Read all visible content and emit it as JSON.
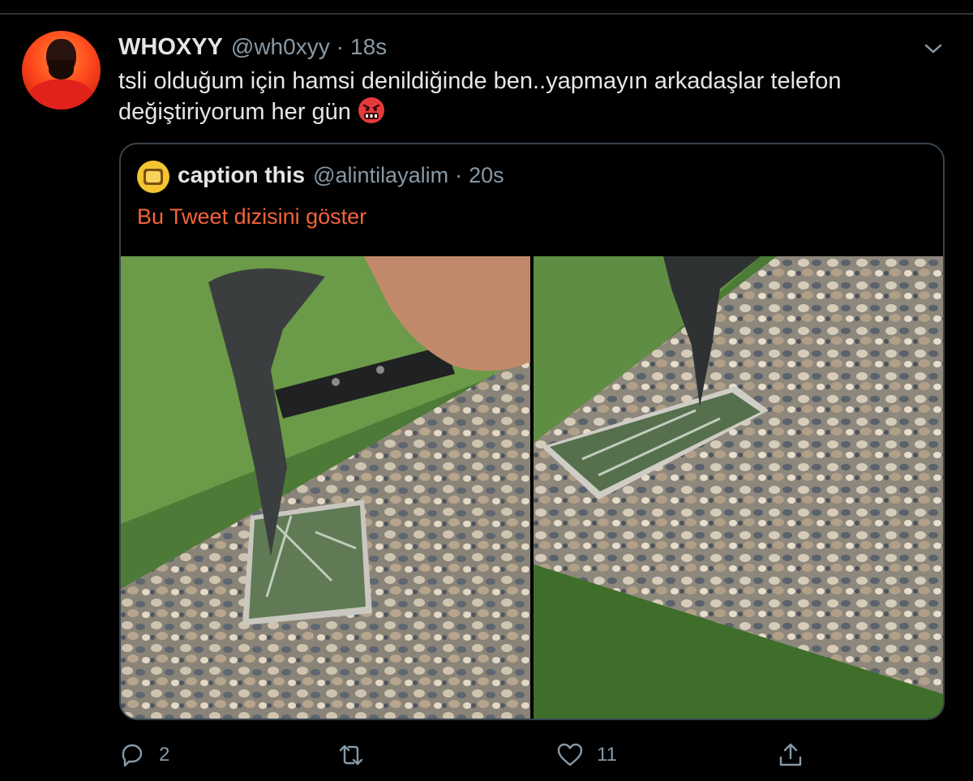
{
  "tweet": {
    "author": {
      "display_name": "WHOXYY",
      "handle": "@wh0xyy",
      "time": "18s"
    },
    "separator": "·",
    "text": "tsli olduğum için hamsi denildiğinde ben..yapmayın arkadaşlar telefon değiştiriyorum her gün",
    "emoji": "angry-face-with-symbols"
  },
  "quoted_tweet": {
    "author": {
      "display_name": "caption this",
      "handle": "@alintilayalim",
      "time": "20s"
    },
    "separator": "·",
    "thread_link": "Bu Tweet dizisini göster",
    "media": [
      {
        "description_icon": "photo-axe-smashing-phone"
      },
      {
        "description_icon": "photo-axe-in-phone"
      }
    ]
  },
  "actions": {
    "reply_count": "2",
    "retweet_count": "",
    "like_count": "11",
    "share_count": ""
  },
  "colors": {
    "background": "#000000",
    "text": "#e6e6e6",
    "secondary": "#8899a6",
    "accent_link": "#f4633a",
    "border": "#38444d"
  }
}
